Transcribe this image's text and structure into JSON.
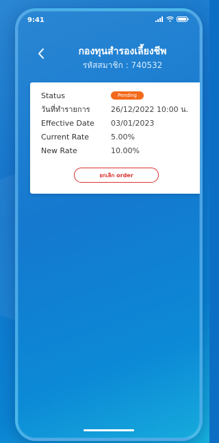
{
  "status_bar": {
    "time": "9:41",
    "icons": [
      "signal-icon",
      "wifi-icon",
      "battery-icon"
    ]
  },
  "header": {
    "back_icon": "chevron-left-icon",
    "title": "กองทุนสำรองเลี้ยงชีพ",
    "subtitle": "รหัสสมาชิก : 740532"
  },
  "details": {
    "rows": [
      {
        "label": "Status",
        "value": "Pending",
        "type": "badge"
      },
      {
        "label": "วันที่ทำรายการ",
        "value": "26/12/2022 10:00 น."
      },
      {
        "label": "Effective Date",
        "value": "03/01/2023"
      },
      {
        "label": "Current Rate",
        "value": "5.00%"
      },
      {
        "label": "New Rate",
        "value": "10.00%"
      }
    ],
    "cancel_label": "ยกเลิก order"
  },
  "colors": {
    "badge": "#f26a1b",
    "cancel": "#d8322f",
    "background": "#1479cf"
  }
}
